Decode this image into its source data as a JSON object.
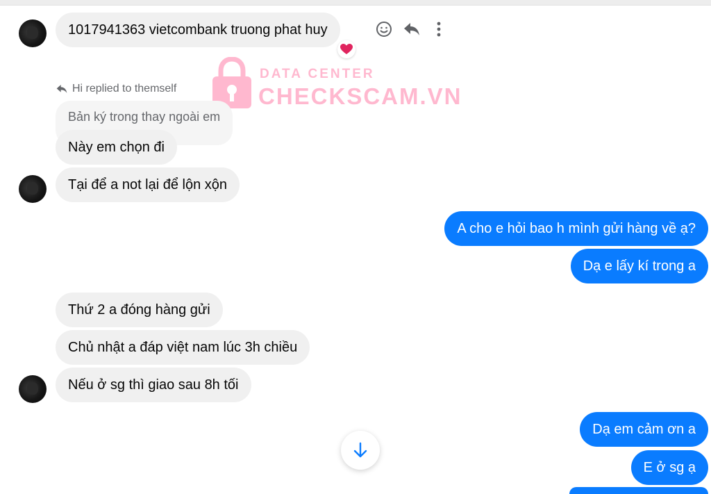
{
  "messages": {
    "m1": "1017941363 vietcombank truong phat huy",
    "reply_note": "Hi replied to themself",
    "quoted": "Bản ký trong thay ngoài em",
    "m2": "Này em chọn đi",
    "m3": "Tại để a not lại để lộn xộn",
    "m4": "A cho e hỏi bao h mình gửi hàng về ạ?",
    "m5": "Dạ e lấy kí trong a",
    "m6": "Thứ 2 a đóng hàng gửi",
    "m7": "Chủ nhật a đáp việt nam lúc 3h chiều",
    "m8": "Nếu ở sg thì giao sau 8h tối",
    "m9": "Dạ em cảm ơn a",
    "m10": "E ở sg ạ"
  },
  "watermark": {
    "small": "DATA CENTER",
    "big": "CHECKSCAM.VN"
  },
  "icons": {
    "react": "smiley-icon",
    "reply": "reply-icon",
    "more": "more-vertical-icon",
    "reaction": "heart-icon",
    "scroll": "arrow-down-icon"
  },
  "colors": {
    "outgoing": "#0a7cff",
    "incoming": "#f0f0f0",
    "accent": "#0a7cff"
  }
}
